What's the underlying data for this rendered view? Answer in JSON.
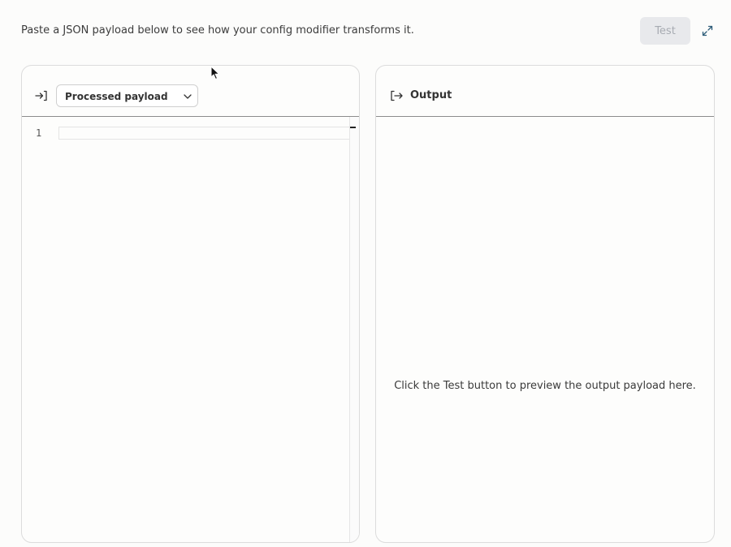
{
  "header": {
    "instructions": "Paste a JSON payload below to see how your config modifier transforms it.",
    "test_label": "Test",
    "expand_icon": "expand-arrows-icon"
  },
  "input_panel": {
    "icon": "input-arrow-icon",
    "selector": {
      "selected": "Processed payload",
      "chevron_icon": "chevron-down-icon"
    },
    "editor": {
      "line_numbers": [
        "1"
      ],
      "value": ""
    }
  },
  "output_panel": {
    "icon": "output-arrow-icon",
    "title": "Output",
    "empty_message": "Click the Test button to preview the output payload here."
  },
  "colors": {
    "background": "#fcfcfb",
    "border": "#dcdcdc",
    "header_divider": "#8c8c8c",
    "disabled_button_bg": "#e8e9ec",
    "disabled_button_text": "#a7abb2",
    "accent_icon": "#2f5e7a"
  }
}
